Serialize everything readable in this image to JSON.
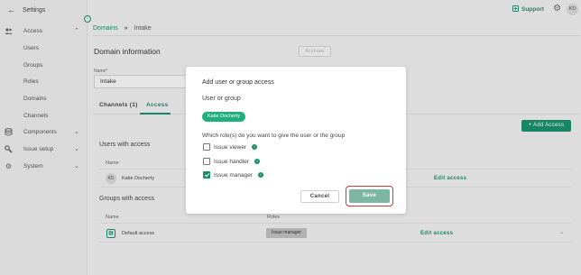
{
  "sidebar": {
    "back_label": "Settings",
    "sections": [
      {
        "label": "Access",
        "icon": "users-icon",
        "expanded": true
      },
      {
        "label": "Components",
        "icon": "database-icon",
        "expanded": false
      },
      {
        "label": "Issue setup",
        "icon": "wrench-icon",
        "expanded": false
      },
      {
        "label": "System",
        "icon": "gear-icon",
        "expanded": false
      }
    ],
    "access_items": [
      "Users",
      "Groups",
      "Roles",
      "Domains",
      "Channels"
    ]
  },
  "topbar": {
    "support_label": "Support",
    "user_initials": "KD"
  },
  "breadcrumb": {
    "link": "Domains",
    "current": "Intake"
  },
  "page": {
    "title": "Domain information",
    "archive_label": "Archive",
    "name_label": "Name*",
    "name_value": "Intake"
  },
  "tabs": [
    {
      "label": "Channels (1)",
      "active": false
    },
    {
      "label": "Access",
      "active": true
    }
  ],
  "add_access_label": "+ Add Access",
  "users_section": {
    "title": "Users with access",
    "col_name": "Name",
    "rows": [
      {
        "initials": "KD",
        "name": "Katie Docherty",
        "action": "Edit access"
      }
    ]
  },
  "groups_section": {
    "title": "Groups with access",
    "col_name": "Name",
    "col_roles": "Roles",
    "rows": [
      {
        "name": "Default access",
        "role": "Issue manager",
        "action": "Edit access"
      }
    ]
  },
  "modal": {
    "title": "Add user or group access",
    "subtitle": "User or group",
    "selected_chip": "Katie Docherty",
    "question": "Which role(s) do you want to give the user or the group",
    "options": [
      {
        "label": "Issue viewer",
        "checked": false
      },
      {
        "label": "Issue handler",
        "checked": false
      },
      {
        "label": "Issue manager",
        "checked": true
      }
    ],
    "cancel_label": "Cancel",
    "save_label": "Save"
  },
  "colors": {
    "accent": "#1a8f6b",
    "chip": "#1db07b",
    "highlight": "#d43a3a"
  }
}
